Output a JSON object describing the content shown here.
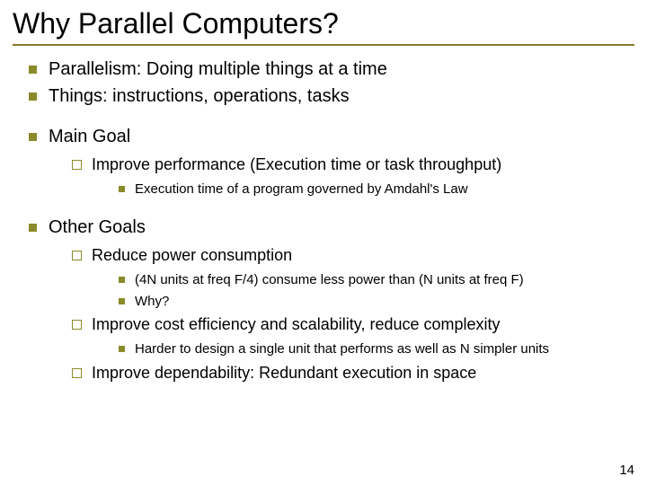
{
  "title": "Why Parallel Computers?",
  "b1": {
    "text": "Parallelism: Doing multiple things at a time"
  },
  "b2": {
    "text": "Things: instructions, operations, tasks"
  },
  "b3": {
    "text": "Main Goal",
    "sub": {
      "s1": {
        "text": "Improve performance (Execution time or task throughput)",
        "sub": {
          "t1": "Execution time of a program governed by Amdahl's Law"
        }
      }
    }
  },
  "b4": {
    "text": "Other Goals",
    "sub": {
      "s1": {
        "text": "Reduce power consumption",
        "sub": {
          "t1": "(4N units at freq F/4) consume less power than (N units at freq F)",
          "t2": "Why?"
        }
      },
      "s2": {
        "text": "Improve cost efficiency and scalability, reduce complexity",
        "sub": {
          "t1": "Harder to design a single unit that performs as well as N simpler units"
        }
      },
      "s3": {
        "text": "Improve dependability: Redundant execution in space"
      }
    }
  },
  "page_number": "14"
}
